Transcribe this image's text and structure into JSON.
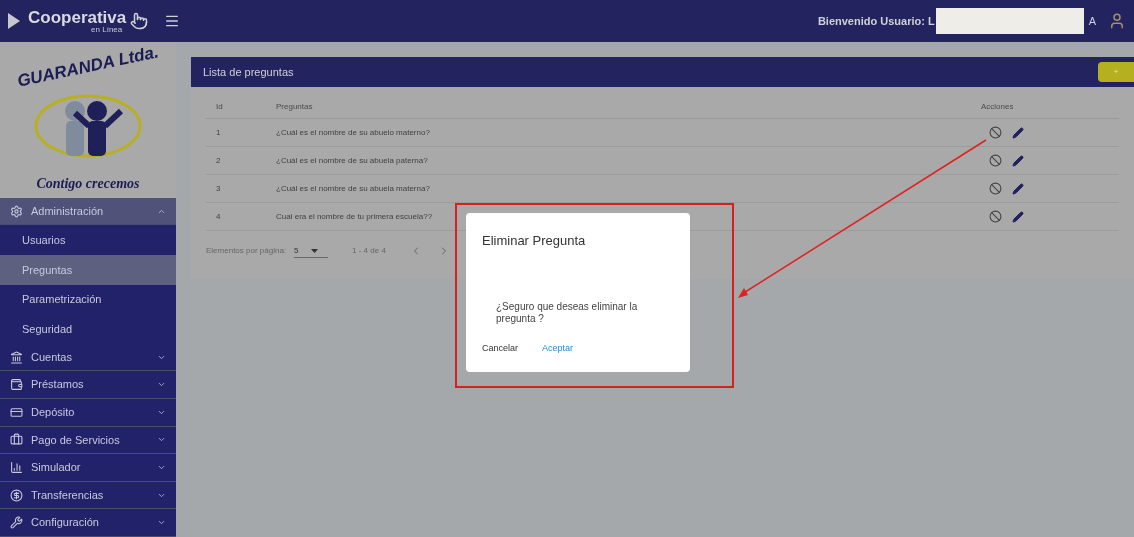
{
  "header": {
    "brand": "Cooperativa",
    "brand_sub": "en Línea",
    "welcome": "Bienvenido Usuario: L",
    "welcome_end": "A"
  },
  "sidebar": {
    "logo_title": "GUARANDA Ltda.",
    "logo_slogan": "Contigo crecemos",
    "items": [
      {
        "label": "Administración",
        "kind": "settings",
        "expanded": true,
        "children": [
          {
            "label": "Usuarios",
            "selected": false
          },
          {
            "label": "Preguntas",
            "selected": true
          },
          {
            "label": "Parametrización",
            "selected": false
          },
          {
            "label": "Seguridad",
            "selected": false
          }
        ]
      },
      {
        "label": "Cuentas",
        "kind": "bank",
        "expanded": false
      },
      {
        "label": "Préstamos",
        "kind": "wallet",
        "expanded": false
      },
      {
        "label": "Depósito",
        "kind": "card",
        "expanded": false
      },
      {
        "label": "Pago de Servicios",
        "kind": "briefcase",
        "expanded": false
      },
      {
        "label": "Simulador",
        "kind": "chart",
        "expanded": false
      },
      {
        "label": "Transferencias",
        "kind": "dollar",
        "expanded": false
      },
      {
        "label": "Configuración",
        "kind": "wrench",
        "expanded": false
      }
    ]
  },
  "card": {
    "title": "Lista de preguntas",
    "add_button": "+",
    "columns": [
      "Id",
      "Preguntas",
      "Acciones"
    ],
    "rows": [
      {
        "id": "1",
        "question": "¿Cuál es el nombre de su abuelo materno?"
      },
      {
        "id": "2",
        "question": "¿Cuál es el nombre de su abuela paterna?"
      },
      {
        "id": "3",
        "question": "¿Cuál es el nombre de su abuela materna?"
      },
      {
        "id": "4",
        "question": "Cual era el nombre de tu primera escuela??"
      }
    ],
    "paginator": {
      "label": "Elementos por página:",
      "page_size": "5",
      "range": "1 - 4 de 4"
    }
  },
  "dialog": {
    "title": "Eliminar Pregunta",
    "message": "¿Seguro que deseas eliminar la pregunta ?",
    "buttons": [
      "Cancelar",
      "Aceptar"
    ]
  }
}
